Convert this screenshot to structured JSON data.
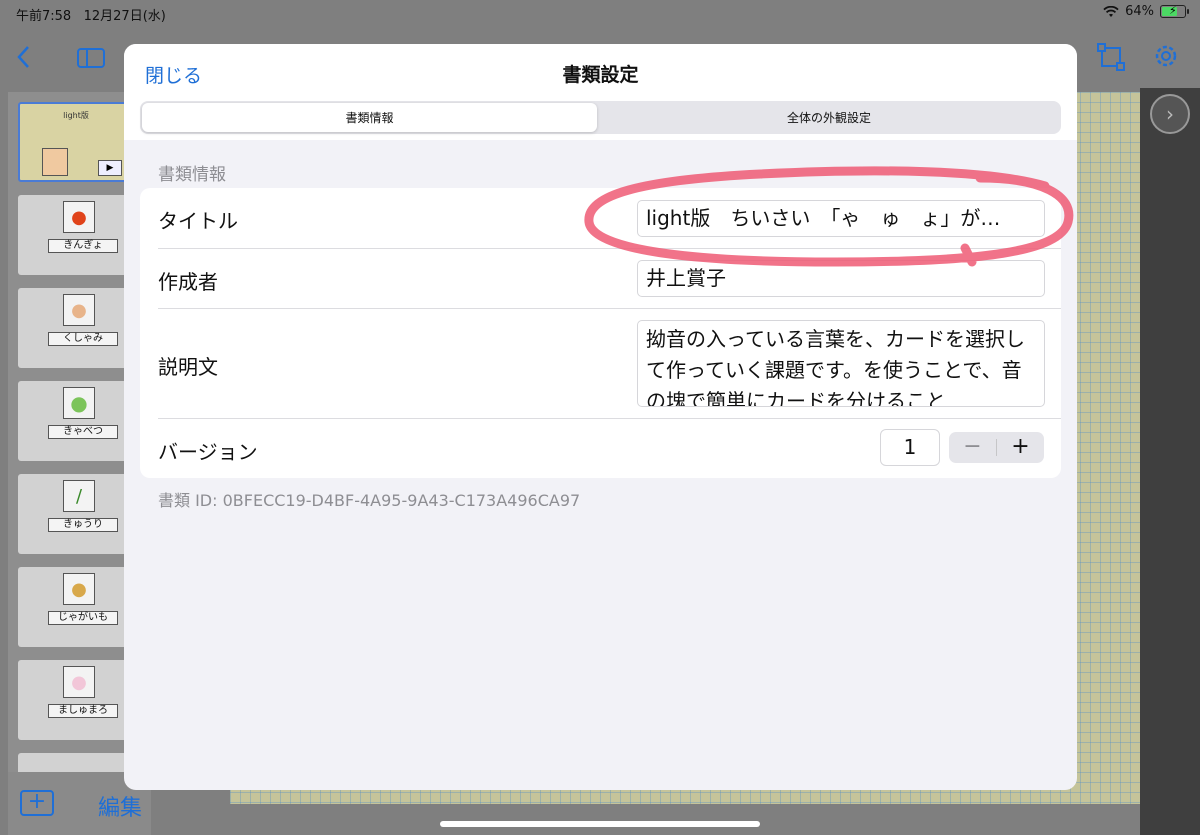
{
  "status_bar": {
    "time": "午前7:58",
    "date": "12月27日(水)",
    "battery": "64%",
    "battery_level": 0.64
  },
  "sidebar": {
    "thumbnails": [
      {
        "label": "light版",
        "selected": true
      },
      {
        "label": "きんぎょ"
      },
      {
        "label": "くしゃみ"
      },
      {
        "label": "きゃべつ"
      },
      {
        "label": "きゅうり"
      },
      {
        "label": "じゃがいも"
      },
      {
        "label": "ましゅまろ"
      }
    ],
    "edit_label": "編集"
  },
  "modal": {
    "close_label": "閉じる",
    "title": "書類設定",
    "tabs": [
      {
        "label": "書類情報",
        "active": true
      },
      {
        "label": "全体の外観設定",
        "active": false
      }
    ],
    "section_header": "書類情報",
    "rows": {
      "title_label": "タイトル",
      "title_value": "light版　ちいさい　「ゃ　ゅ　ょ」が…",
      "author_label": "作成者",
      "author_value": "井上賞子",
      "description_label": "説明文",
      "description_value": "拗音の入っている言葉を、カードを選択して作っていく課題です。を使うことで、音の塊で簡単にカードを分けること",
      "version_label": "バージョン",
      "version_value": "1"
    },
    "stepper": {
      "minus": "−",
      "plus": "+"
    },
    "document_id": "書類 ID: 0BFECC19-D4BF-4A95-9A43-C173A496CA97"
  },
  "colors": {
    "accent": "#1f6fd6",
    "annotation": "#ee5a74"
  }
}
